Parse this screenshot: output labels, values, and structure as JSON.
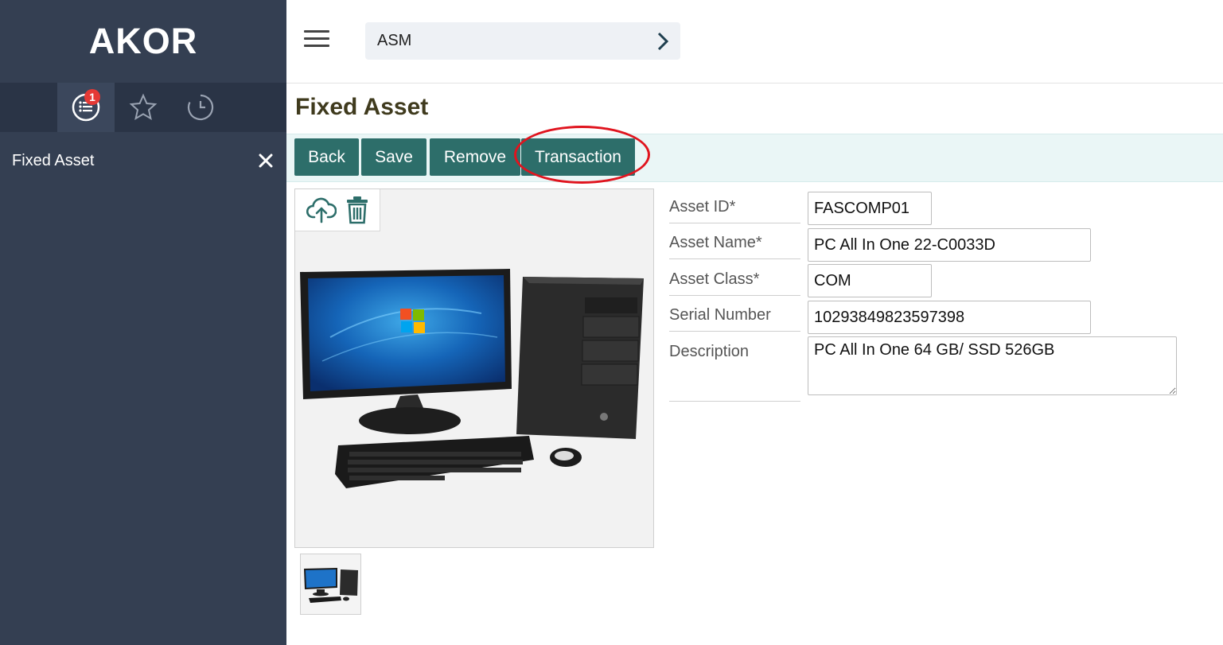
{
  "sidebar": {
    "brand": "AKOR",
    "tabs": [
      {
        "icon": "list-icon",
        "badge": "1",
        "active": true
      },
      {
        "icon": "star-icon"
      },
      {
        "icon": "history-icon"
      }
    ],
    "items": [
      {
        "label": "Fixed Asset"
      }
    ]
  },
  "topbar": {
    "breadcrumb": "ASM"
  },
  "page": {
    "title": "Fixed Asset"
  },
  "toolbar": {
    "back_label": "Back",
    "save_label": "Save",
    "remove_label": "Remove",
    "transaction_label": "Transaction"
  },
  "form": {
    "asset_id": {
      "label": "Asset ID*",
      "value": "FASCOMP01"
    },
    "asset_name": {
      "label": "Asset Name*",
      "value": "PC All In One 22-C0033D"
    },
    "asset_class": {
      "label": "Asset Class*",
      "value": "COM"
    },
    "serial_number": {
      "label": "Serial Number",
      "value": "10293849823597398"
    },
    "description": {
      "label": "Description",
      "value": "PC All In One 64 GB/ SSD 526GB"
    }
  },
  "colors": {
    "sidebar_bg": "#343f52",
    "accent_button": "#2d6e6a",
    "toolbar_bg": "#eaf6f6",
    "badge": "#e53935",
    "annotation_ring": "#e0141e"
  }
}
